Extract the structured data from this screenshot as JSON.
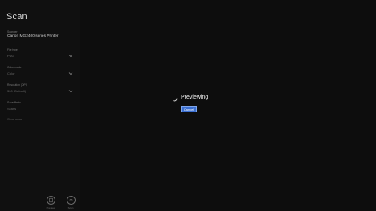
{
  "app": {
    "title": "Scan"
  },
  "scanner": {
    "label": "Scanner",
    "value": "Canon MG2400 series Printer"
  },
  "file_type": {
    "label": "File type",
    "value": "PNG"
  },
  "color_mode": {
    "label": "Color mode",
    "value": "Color"
  },
  "resolution": {
    "label": "Resolution (DPI)",
    "value": "300 (Default)"
  },
  "save_file_to": {
    "label": "Save file to",
    "value": "Scans"
  },
  "show_more": "Show more",
  "bottom_bar": {
    "preview_label": "Preview",
    "scan_label": "Scan"
  },
  "overlay": {
    "status_text": "Previewing",
    "cancel_label": "Cancel"
  },
  "colors": {
    "accent": "#3b6fd1",
    "background": "#0d0d0d"
  }
}
